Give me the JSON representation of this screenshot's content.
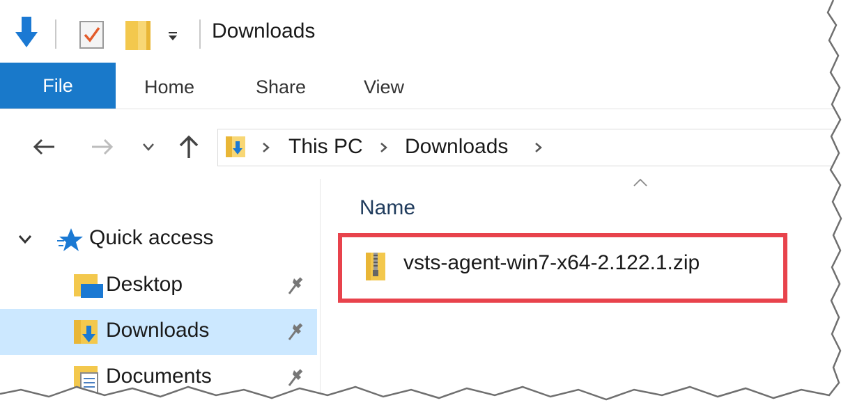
{
  "window": {
    "title": "Downloads",
    "quick_access_toolbar": [
      {
        "icon": "down-arrow-icon"
      },
      {
        "icon": "properties-icon"
      },
      {
        "icon": "new-folder-icon"
      },
      {
        "icon": "customize-dropdown-icon"
      }
    ]
  },
  "ribbon": {
    "tabs": [
      {
        "label": "File",
        "active": true
      },
      {
        "label": "Home"
      },
      {
        "label": "Share"
      },
      {
        "label": "View"
      }
    ],
    "colors": {
      "file_tab": "#1979ca"
    }
  },
  "navigation": {
    "buttons": [
      "back-arrow-icon",
      "forward-arrow-icon",
      "recent-locations-icon",
      "up-arrow-icon"
    ],
    "breadcrumb": [
      "This PC",
      "Downloads"
    ]
  },
  "sidebar": {
    "section": "Quick access",
    "items": [
      {
        "label": "Desktop",
        "pinned": true
      },
      {
        "label": "Downloads",
        "pinned": true,
        "selected": true
      },
      {
        "label": "Documents",
        "pinned": true
      }
    ],
    "colors": {
      "selected": "#cce8ff"
    }
  },
  "content": {
    "column_header": "Name",
    "files": [
      {
        "name": "vsts-agent-win7-x64-2.122.1.zip",
        "icon": "zip-folder-icon",
        "highlighted": true
      }
    ],
    "colors": {
      "highlight": "#e8434c"
    }
  }
}
